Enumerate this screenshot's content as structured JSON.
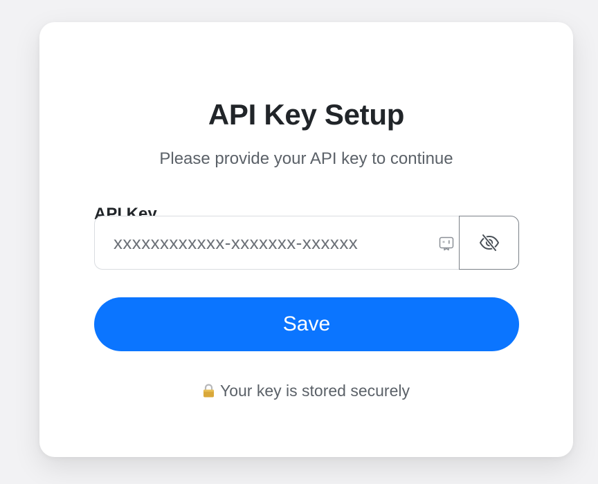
{
  "card": {
    "title": "API Key Setup",
    "subtitle": "Please provide your API key to continue"
  },
  "api_key_field": {
    "label": "API Key",
    "value": "xxxxxxxxxxxx-xxxxxxx-xxxxxx",
    "autofill_icon": "password-autofill-icon",
    "toggle_icon": "eye-slash-icon"
  },
  "save_button": {
    "label": "Save"
  },
  "security_note": {
    "icon": "lock-icon",
    "text": "Your key is stored securely"
  },
  "colors": {
    "primary": "#0b75ff",
    "title_text": "#212529",
    "muted_text": "#5b6168",
    "input_border": "#d9dce0",
    "toggle_border": "#7a8087",
    "page_background": "#f2f2f4",
    "card_background": "#ffffff"
  }
}
